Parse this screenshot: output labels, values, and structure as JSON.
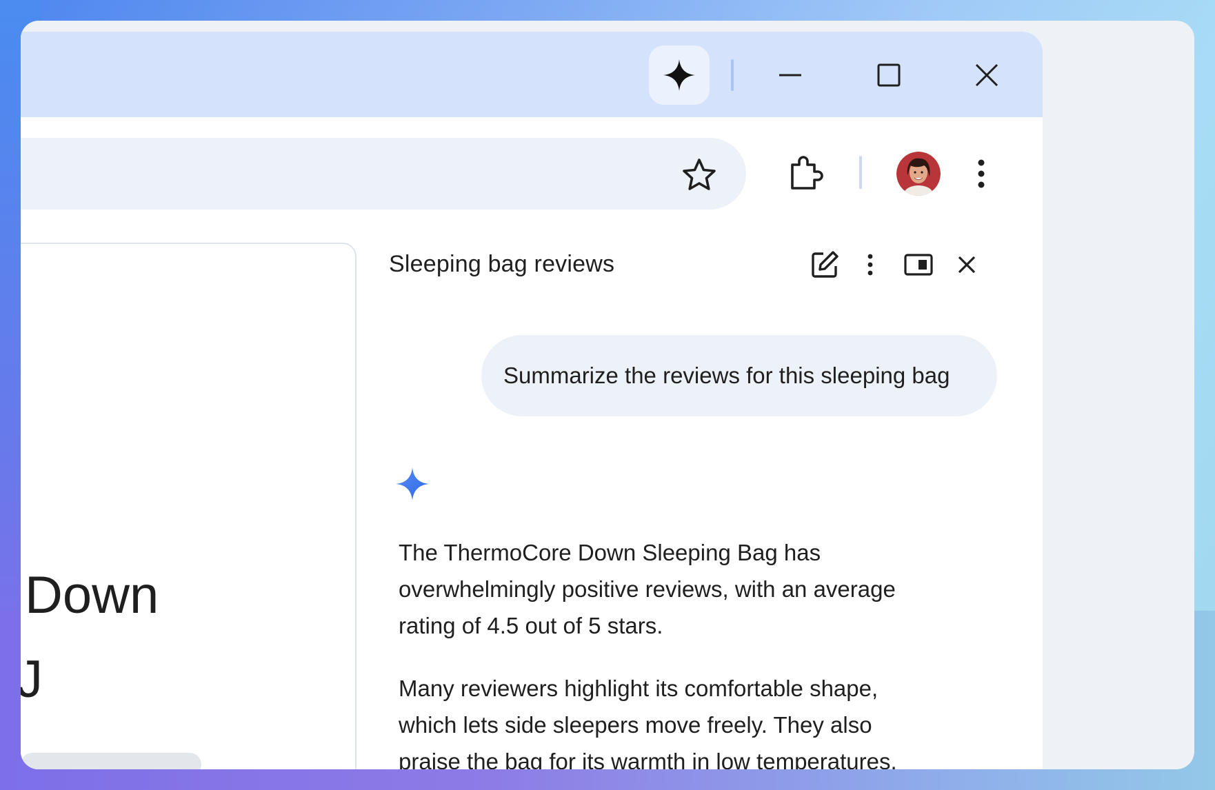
{
  "window": {
    "title_icon": "gemini-sparkle-icon",
    "controls": [
      "minimize-icon",
      "maximize-icon",
      "close-icon"
    ]
  },
  "toolbar": {
    "icons": [
      "star-icon",
      "extensions-icon",
      "avatar",
      "more-vert-icon"
    ]
  },
  "page": {
    "visible_text_1": "Down",
    "visible_text_2": "J"
  },
  "side_panel": {
    "title": "Sleeping bag reviews",
    "actions": [
      "edit-icon",
      "more-vert-icon",
      "open-in-window-icon",
      "close-icon"
    ],
    "user_message": "Summarize the reviews for this sleeping bag",
    "response": {
      "icon": "gemini-sparkle-icon",
      "paragraph_1_lines": [
        "The ThermoCore Down Sleeping Bag has",
        "overwhelmingly positive reviews, with an average",
        "rating of 4.5 out of 5 stars."
      ],
      "paragraph_2_lines": [
        "Many reviewers highlight its comfortable shape,",
        "which lets side sleepers move freely. They also",
        "praise the bag for its warmth in low temperatures."
      ]
    }
  },
  "colors": {
    "titlebar": "#d4e3fb",
    "omnibox": "#edf1f8",
    "gemini_blue": "#3b7cf0"
  }
}
